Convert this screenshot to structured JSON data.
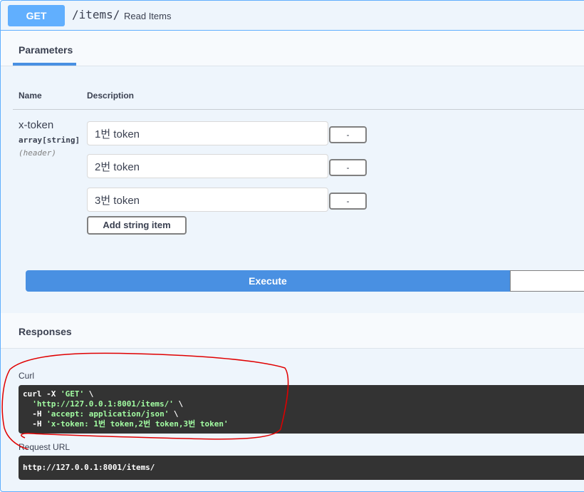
{
  "summary": {
    "method": "GET",
    "path": "/items/",
    "description": "Read Items"
  },
  "parameters": {
    "tab_label": "Parameters",
    "col_name": "Name",
    "col_description": "Description",
    "param": {
      "name": "x-token",
      "type": "array[string]",
      "in": "(header)",
      "items": [
        "1번 token",
        "2번 token",
        "3번 token"
      ],
      "remove_label": "-",
      "add_label": "Add string item"
    },
    "execute_label": "Execute"
  },
  "responses": {
    "title": "Responses",
    "curl_label": "Curl",
    "curl": {
      "cmd": "curl -X ",
      "method": "'GET'",
      "cont": " \\",
      "url": "'http://127.0.0.1:8001/items/'",
      "h1_flag": "  -H ",
      "h1": "'accept: application/json'",
      "h2_flag": "  -H ",
      "h2": "'x-token: 1번 token,2번 token,3번 token'"
    },
    "request_url_label": "Request URL",
    "request_url": "http://127.0.0.1:8001/items/"
  },
  "colors": {
    "get_blue": "#61affe",
    "execute_blue": "#4990e2",
    "code_bg": "#333333",
    "annotation_red": "#e00000"
  }
}
